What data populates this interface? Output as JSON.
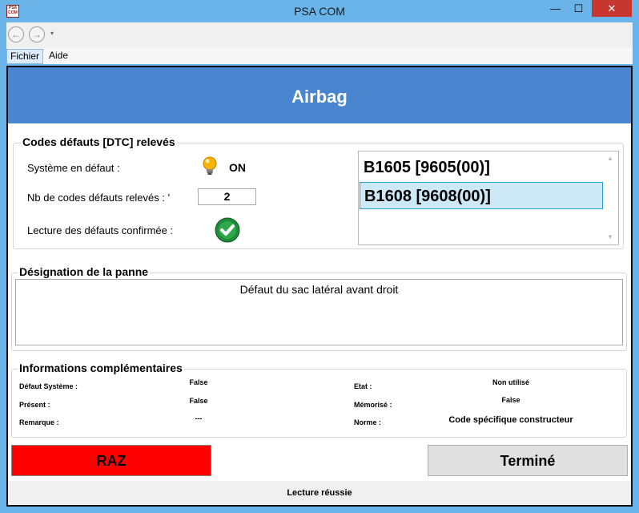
{
  "window": {
    "title": "PSA COM",
    "icon_text": "PSA COM",
    "minimize_glyph": "—",
    "maximize_glyph": "☐",
    "close_glyph": "✕"
  },
  "toolbar": {
    "back_glyph": "←",
    "forward_glyph": "→",
    "dropdown_glyph": "▾"
  },
  "menu": {
    "items": [
      {
        "label": "Fichier"
      },
      {
        "label": "Aide"
      }
    ]
  },
  "header": {
    "title": "Airbag",
    "color": "#4a86d0"
  },
  "dtc_group": {
    "title": "Codes défauts [DTC] relevés",
    "system_label": "Système en défaut :",
    "system_status_icon": "lightbulb-on-icon",
    "system_status": "ON",
    "count_label": "Nb de codes défauts relevés : '",
    "count_value": "2",
    "confirmed_label": "Lecture des défauts confirmée :",
    "confirmed_icon": "checkmark-icon",
    "codes": [
      {
        "text": "B1605 [9605(00)]",
        "selected": false
      },
      {
        "text": "B1608 [9608(00)]",
        "selected": true
      }
    ]
  },
  "designation": {
    "title": "Désignation de la panne",
    "text": "Défaut du sac latéral avant droit"
  },
  "info": {
    "title": "Informations complémentaires",
    "left": [
      {
        "label": "Défaut Système :",
        "value": "False"
      },
      {
        "label": "Présent :",
        "value": "False"
      },
      {
        "label": "Remarque :",
        "value": "---"
      }
    ],
    "right": [
      {
        "label": "Etat :",
        "value": "Non utilisé"
      },
      {
        "label": "Mémorisé :",
        "value": "False"
      },
      {
        "label": "Norme :",
        "value": "Code spécifique constructeur"
      }
    ]
  },
  "buttons": {
    "raz": "RAZ",
    "termine": "Terminé",
    "raz_color": "#ff0000"
  },
  "status": {
    "text": "Lecture réussie"
  }
}
